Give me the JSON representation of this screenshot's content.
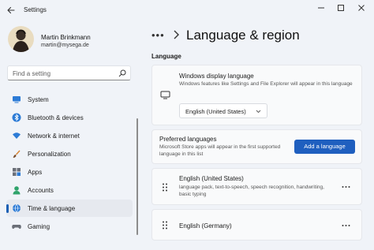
{
  "app": {
    "title": "Settings"
  },
  "user": {
    "name": "Martin Brinkmann",
    "email": "martin@mysega.de"
  },
  "search": {
    "placeholder": "Find a setting"
  },
  "sidebar": {
    "items": [
      {
        "label": "System",
        "icon": "monitor-icon"
      },
      {
        "label": "Bluetooth & devices",
        "icon": "bluetooth-icon"
      },
      {
        "label": "Network & internet",
        "icon": "wifi-icon"
      },
      {
        "label": "Personalization",
        "icon": "brush-icon"
      },
      {
        "label": "Apps",
        "icon": "apps-icon"
      },
      {
        "label": "Accounts",
        "icon": "person-icon"
      },
      {
        "label": "Time & language",
        "icon": "globe-clock-icon",
        "active": true
      },
      {
        "label": "Gaming",
        "icon": "gamepad-icon"
      }
    ]
  },
  "header": {
    "breadcrumb_overflow": "•••",
    "title": "Language & region"
  },
  "language_section": {
    "label": "Language",
    "display_language": {
      "title": "Windows display language",
      "description": "Windows features like Settings and File Explorer will appear in this language",
      "selected": "English (United States)"
    },
    "preferred": {
      "title": "Preferred languages",
      "description": "Microsoft Store apps will appear in the first supported language in this list",
      "add_button": "Add a language"
    },
    "languages": [
      {
        "name": "English (United States)",
        "details": "language pack, text-to-speech, speech recognition, handwriting, basic typing"
      },
      {
        "name": "English (Germany)",
        "details": ""
      }
    ]
  },
  "colors": {
    "accent": "#1f5fbf",
    "background": "#f0f3f8",
    "card": "#f9fafb"
  }
}
